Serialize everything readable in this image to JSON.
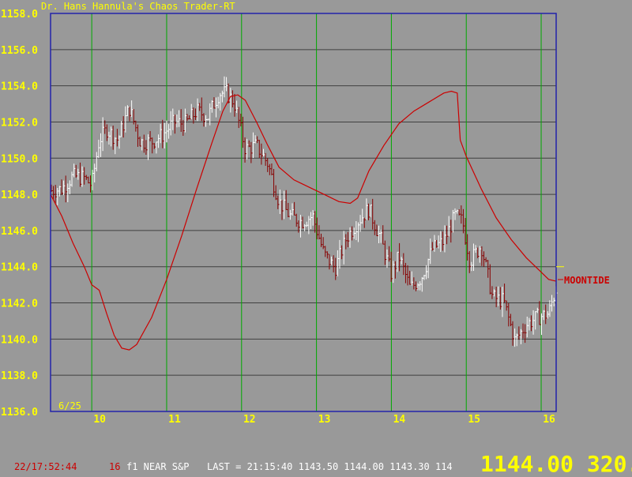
{
  "title": "Dr. Hans Hannula's Chaos Trader-RT",
  "status": {
    "time": "22/17:52:44",
    "id": "16",
    "symbol": "f1 NEAR S&P",
    "last": "LAST = 21:15:40 1143.50 1144.00 1143.30 114",
    "big": "1144.00 320.0"
  },
  "colors": {
    "background": "#999999",
    "grid_horizontal": "#404040",
    "grid_vertical": "#00aa00",
    "frame": "#2222aa",
    "axis_text": "#ffff00",
    "price_bar_up": "#ffffff",
    "price_bar_down": "#880000",
    "moontide": "#cc0000"
  },
  "chart_data": {
    "type": "line",
    "ylim": [
      1136.0,
      1158.0
    ],
    "xlim": [
      9.45,
      16.2
    ],
    "ytick_labels": [
      "1136.0",
      "1138.0",
      "1140.0",
      "1142.0",
      "1144.0",
      "1146.0",
      "1148.0",
      "1150.0",
      "1152.0",
      "1154.0",
      "1156.0",
      "1158.0"
    ],
    "xtick_labels": [
      "10",
      "11",
      "12",
      "13",
      "14",
      "15",
      "16"
    ],
    "date_label": "6/25",
    "grid": true,
    "price_marker": 1144.0,
    "series": [
      {
        "name": "MOONTIDE",
        "x": [
          9.45,
          9.6,
          9.75,
          9.9,
          10.0,
          10.1,
          10.2,
          10.3,
          10.4,
          10.5,
          10.6,
          10.8,
          11.0,
          11.2,
          11.4,
          11.6,
          11.75,
          11.85,
          11.95,
          12.05,
          12.2,
          12.35,
          12.5,
          12.7,
          12.9,
          13.1,
          13.3,
          13.45,
          13.55,
          13.7,
          13.9,
          14.1,
          14.3,
          14.5,
          14.7,
          14.8,
          14.88,
          14.92,
          15.0,
          15.2,
          15.4,
          15.6,
          15.8,
          16.0,
          16.1,
          16.2
        ],
        "y": [
          1148.0,
          1146.8,
          1145.3,
          1144.0,
          1143.0,
          1142.7,
          1141.4,
          1140.2,
          1139.5,
          1139.4,
          1139.7,
          1141.2,
          1143.3,
          1145.7,
          1148.3,
          1150.8,
          1152.6,
          1153.4,
          1153.5,
          1153.2,
          1152.0,
          1150.7,
          1149.5,
          1148.8,
          1148.4,
          1148.0,
          1147.6,
          1147.5,
          1147.8,
          1149.3,
          1150.7,
          1151.9,
          1152.6,
          1153.1,
          1153.6,
          1153.7,
          1153.6,
          1151.0,
          1150.1,
          1148.3,
          1146.7,
          1145.5,
          1144.5,
          1143.7,
          1143.3,
          1143.2
        ]
      },
      {
        "name": "price",
        "x": [
          9.45,
          9.6,
          9.75,
          9.9,
          10.0,
          10.1,
          10.2,
          10.35,
          10.5,
          10.65,
          10.8,
          10.95,
          11.1,
          11.25,
          11.4,
          11.55,
          11.7,
          11.8,
          11.9,
          12.05,
          12.2,
          12.35,
          12.5,
          12.65,
          12.8,
          12.95,
          13.1,
          13.25,
          13.4,
          13.55,
          13.7,
          13.85,
          14.0,
          14.1,
          14.25,
          14.4,
          14.55,
          14.7,
          14.85,
          14.95,
          15.05,
          15.2,
          15.35,
          15.5,
          15.65,
          15.8,
          15.95,
          16.1,
          16.2
        ],
        "y": [
          1148.2,
          1148.3,
          1149.0,
          1148.9,
          1148.5,
          1151.0,
          1151.6,
          1151.0,
          1152.8,
          1150.9,
          1150.9,
          1151.3,
          1152.0,
          1151.9,
          1152.6,
          1152.3,
          1153.6,
          1153.6,
          1153.1,
          1150.5,
          1150.7,
          1149.7,
          1147.6,
          1146.8,
          1146.5,
          1146.8,
          1144.7,
          1143.9,
          1145.6,
          1146.5,
          1147.2,
          1145.6,
          1143.6,
          1144.6,
          1142.8,
          1143.4,
          1145.0,
          1145.4,
          1146.8,
          1146.5,
          1144.3,
          1145.2,
          1142.3,
          1142.1,
          1139.9,
          1140.8,
          1141.2,
          1141.4,
          1142.8
        ]
      }
    ]
  }
}
